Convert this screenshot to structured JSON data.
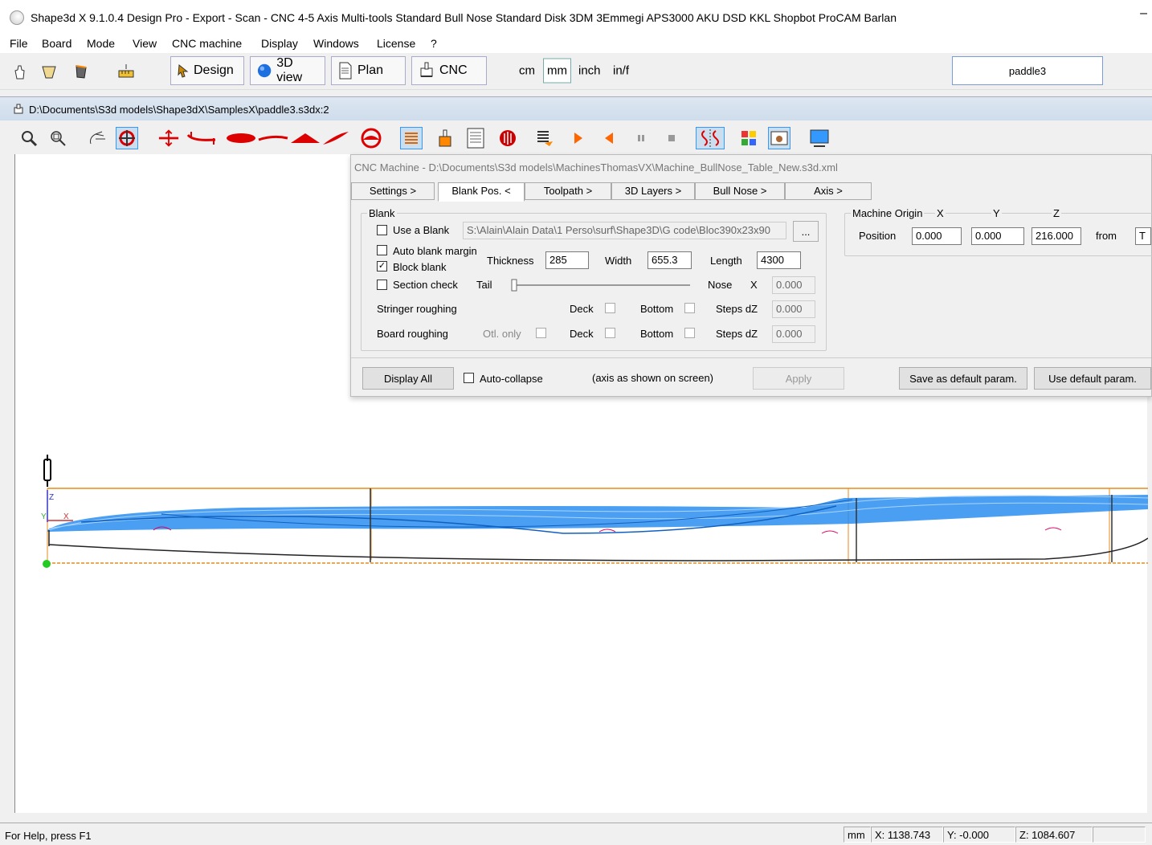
{
  "window": {
    "title": "Shape3d X 9.1.0.4 Design Pro - Export - Scan - CNC 4-5 Axis Multi-tools  Standard Bull Nose Standard Disk 3DM 3Emmegi APS3000 AKU DSD KKL Shopbot ProCAM Barlan",
    "minimize": "–"
  },
  "menu": [
    "File",
    "Board",
    "Mode",
    "View",
    "CNC machine",
    "Display",
    "Windows",
    "License",
    "?"
  ],
  "toolbar": {
    "design": "Design",
    "view3d": "3D view",
    "plan": "Plan",
    "cnc": "CNC",
    "units": [
      "cm",
      "mm",
      "inch",
      "in/f"
    ],
    "selected_unit": "mm",
    "board_name": "paddle3"
  },
  "document": {
    "path": "D:\\Documents\\S3d models\\Shape3dX\\SamplesX\\paddle3.s3dx:2"
  },
  "cnc": {
    "title": "CNC Machine - D:\\Documents\\S3d models\\MachinesThomasVX\\Machine_BullNose_Table_New.s3d.xml",
    "tabs": [
      "Settings >",
      "Blank Pos. <",
      "Toolpath >",
      "3D Layers >",
      "Bull Nose >",
      "Axis >"
    ],
    "blank": {
      "group": "Blank",
      "use_blank": "Use a Blank",
      "blank_path": "S:\\Alain\\Alain Data\\1 Perso\\surf\\Shape3D\\G code\\Bloc390x23x90",
      "browse": "...",
      "auto_margin": "Auto blank margin",
      "block_blank": "Block blank",
      "thickness_lbl": "Thickness",
      "thickness": "285",
      "width_lbl": "Width",
      "width": "655.3",
      "length_lbl": "Length",
      "length": "4300",
      "section_check": "Section check",
      "tail": "Tail",
      "nose": "Nose",
      "x": "X",
      "nose_x": "0.000",
      "stringer": "Stringer roughing",
      "board": "Board roughing",
      "otl_only": "Otl. only",
      "deck": "Deck",
      "bottom": "Bottom",
      "steps_dz": "Steps dZ",
      "stringer_dz": "0.000",
      "board_dz": "0.000"
    },
    "origin": {
      "group": "Machine Origin",
      "x": "X",
      "y": "Y",
      "z": "Z",
      "position": "Position",
      "px": "0.000",
      "py": "0.000",
      "pz": "216.000",
      "from": "from",
      "from_val": "T"
    },
    "bottom_bar": {
      "display_all": "Display All",
      "auto_collapse": "Auto-collapse",
      "axis_note": "(axis as shown on screen)",
      "apply": "Apply",
      "save_default": "Save as default param.",
      "use_default": "Use default param."
    }
  },
  "status": {
    "help": "For Help, press F1",
    "unit": "mm",
    "x": "X: 1138.743",
    "y": "Y: -0.000",
    "z": "Z: 1084.607"
  },
  "axis_labels": {
    "z": "Z",
    "x": "X",
    "y": "Y"
  }
}
